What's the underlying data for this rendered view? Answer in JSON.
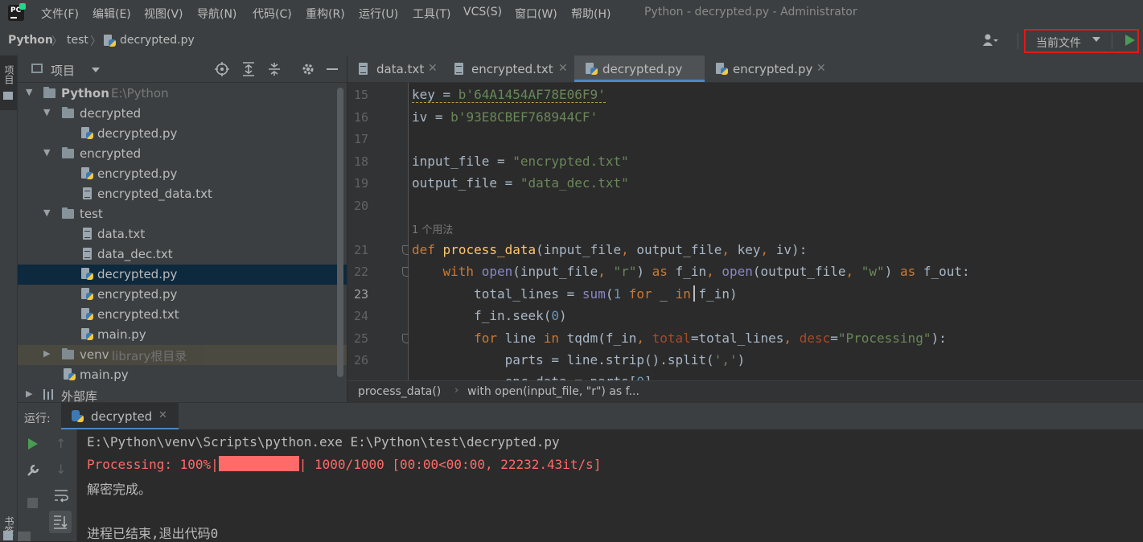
{
  "menu": {
    "items": [
      "文件(F)",
      "编辑(E)",
      "视图(V)",
      "导航(N)",
      "代码(C)",
      "重构(R)",
      "运行(U)",
      "工具(T)",
      "VCS(S)",
      "窗口(W)",
      "帮助(H)"
    ],
    "window_title": "Python - decrypted.py - Administrator"
  },
  "navbar": {
    "crumbs": [
      "Python",
      "test",
      "decrypted.py"
    ],
    "run_config": "当前文件"
  },
  "left_strip": {
    "project_label": "项目",
    "bookmarks_label": "书签"
  },
  "project_panel": {
    "title": "项目",
    "tree": [
      {
        "label": "Python",
        "sub": "E:\\Python"
      },
      {
        "label": "decrypted"
      },
      {
        "label": "decrypted.py"
      },
      {
        "label": "encrypted"
      },
      {
        "label": "encrypted.py"
      },
      {
        "label": "encrypted_data.txt"
      },
      {
        "label": "test"
      },
      {
        "label": "data.txt"
      },
      {
        "label": "data_dec.txt"
      },
      {
        "label": "decrypted.py"
      },
      {
        "label": "encrypted.py"
      },
      {
        "label": "encrypted.txt"
      },
      {
        "label": "main.py"
      },
      {
        "label": "venv",
        "sub": "library根目录"
      },
      {
        "label": "main.py"
      },
      {
        "label": "外部库"
      }
    ]
  },
  "editor": {
    "tabs": [
      "data.txt",
      "encrypted.txt",
      "decrypted.py",
      "encrypted.py"
    ],
    "active_tab": "decrypted.py",
    "line_numbers": [
      "15",
      "16",
      "17",
      "18",
      "19",
      "20",
      "21",
      "22",
      "23",
      "24",
      "25",
      "26"
    ],
    "usage_hint": "1 个用法",
    "breadcrumb": [
      "process_data()",
      "with open(input_file, \"r\") as f..."
    ]
  },
  "run_panel": {
    "label": "运行:",
    "tab": "decrypted",
    "console": {
      "command": "E:\\Python\\venv\\Scripts\\python.exe E:\\Python\\test\\decrypted.py",
      "progress_prefix": "Processing: 100%|",
      "progress_suffix": "| 1000/1000 [00:00<00:00, 22232.43it/s]",
      "progress_fraction": 1.0,
      "done": "解密完成。",
      "exit": "进程已结束,退出代码0"
    }
  },
  "colors": {
    "accent": "#4a88c7",
    "run_green": "#499c54",
    "highlight_red": "#e11919",
    "console_red": "#ff6b68"
  }
}
